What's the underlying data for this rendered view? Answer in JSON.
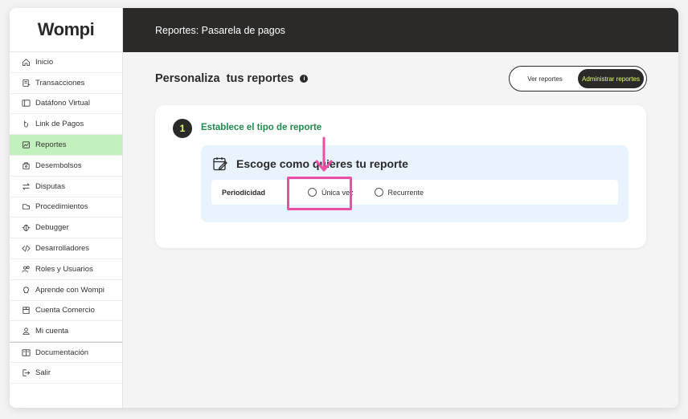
{
  "app": {
    "logo": "Wompi"
  },
  "header": {
    "title": "Reportes: Pasarela de pagos"
  },
  "sidebar": {
    "items": [
      {
        "label": "Inicio",
        "icon": "home-icon"
      },
      {
        "label": "Transacciones",
        "icon": "transactions-icon"
      },
      {
        "label": "Datáfono Virtual",
        "icon": "pos-icon"
      },
      {
        "label": "Link de Pagos",
        "icon": "link-icon"
      },
      {
        "label": "Reportes",
        "icon": "reports-icon",
        "active": true
      },
      {
        "label": "Desembolsos",
        "icon": "wallet-icon"
      },
      {
        "label": "Disputas",
        "icon": "disputes-icon"
      },
      {
        "label": "Procedimientos",
        "icon": "procedures-icon"
      },
      {
        "label": "Debugger",
        "icon": "bug-icon"
      },
      {
        "label": "Desarrolladores",
        "icon": "code-icon"
      },
      {
        "label": "Roles y Usuarios",
        "icon": "users-icon"
      },
      {
        "label": "Aprende con Wompi",
        "icon": "bulb-icon"
      },
      {
        "label": "Cuenta Comercio",
        "icon": "store-icon"
      },
      {
        "label": "Mi cuenta",
        "icon": "user-icon"
      },
      {
        "label": "Documentación",
        "icon": "docs-icon"
      },
      {
        "label": "Salir",
        "icon": "logout-icon"
      }
    ]
  },
  "main": {
    "title": "Personaliza  tus reportes",
    "toggle": {
      "option1": "Ver reportes",
      "option2": "Administrar reportes",
      "selected": "Administrar reportes"
    },
    "step": {
      "number": "1",
      "title": "Establece el tipo de reporte"
    },
    "section": {
      "title": "Escoge como quieres tu reporte",
      "row_label": "Periodicidad",
      "options": [
        "Única vez",
        "Recurrente"
      ]
    }
  },
  "colors": {
    "dark": "#2b2a29",
    "accent_green": "#c3f1bd",
    "step_green": "#1f8a4c",
    "highlight_pink": "#ec4fa6",
    "lime": "#dffd77"
  }
}
